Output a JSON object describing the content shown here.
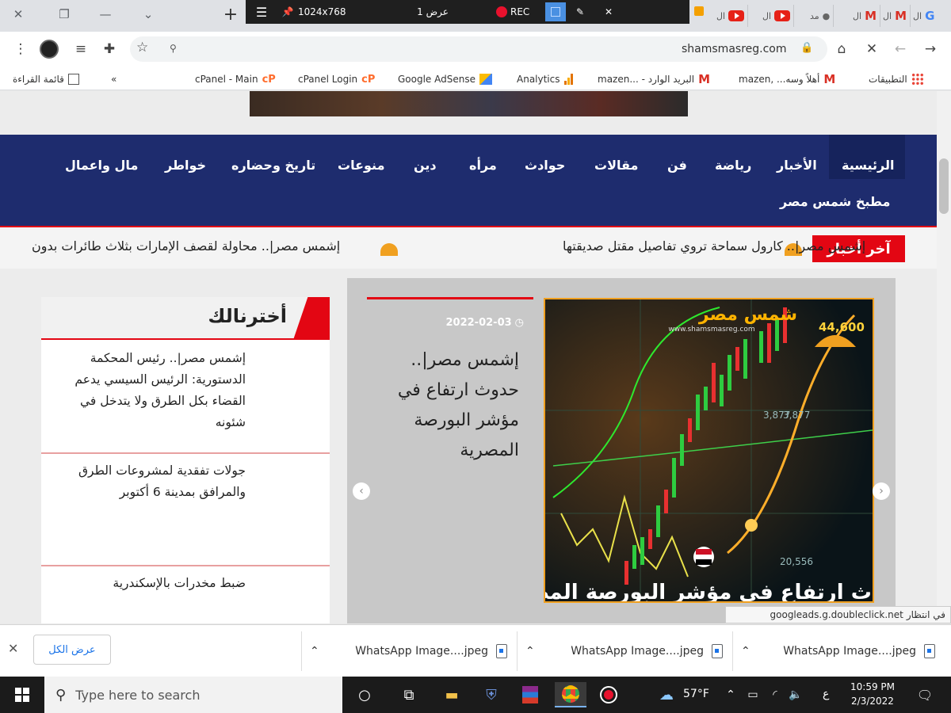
{
  "browser": {
    "tabs": [
      {
        "label": "ال",
        "icon": "youtube-icon"
      },
      {
        "label": "ال",
        "icon": "youtube-icon"
      },
      {
        "label": "مد",
        "icon": "user-icon"
      },
      {
        "label": "ال",
        "icon": "gmail-icon"
      },
      {
        "label": "ال",
        "icon": "gmail-icon"
      },
      {
        "label": "ال",
        "icon": "google-icon"
      }
    ],
    "address": "shamsmasreg.com",
    "zoom": "90",
    "bookmarks": [
      {
        "label": "التطبيقات",
        "icon": "apps-grid-icon"
      },
      {
        "label": "أهلاً وسه... ,mazen",
        "icon": "gmail-icon"
      },
      {
        "label": "البريد الوارد - ...mazen",
        "icon": "gmail-icon"
      },
      {
        "label": "Analytics",
        "icon": "analytics-icon"
      },
      {
        "label": "Google AdSense",
        "icon": "adsense-icon"
      },
      {
        "label": "cPanel Login",
        "icon": "cpanel-icon"
      },
      {
        "label": "cPanel - Main",
        "icon": "cpanel-icon"
      }
    ],
    "reading_list": "قائمة القراءة",
    "more_bookmarks": "«"
  },
  "recording": {
    "resolution": "1024x768",
    "display": "عرض 1",
    "rec_label": "REC"
  },
  "site": {
    "nav": [
      "الرئيسية",
      "الأخبار",
      "رياضة",
      "فن",
      "مقالات",
      "حوادث",
      "مرأه",
      "دين",
      "منوعات",
      "تاريخ وحضاره",
      "خواطر",
      "مال واعمال"
    ],
    "nav_row2": "مطبخ شمس مصر",
    "ticker_label": "آخر أخبار",
    "ticker": [
      "إشمس مصر|.. كارول سماحة تروي تفاصيل مقتل صديقتها",
      "إشمس مصر|.. محاولة لقصف الإمارات بثلاث طائرات بدون"
    ],
    "slide": {
      "date": "2022-02-03",
      "title": "إشمس مصر|.. حدوث ارتفاع في مؤشر البورصة المصرية",
      "logo_text": "شمس مصر",
      "logo_url": "www.shamsmasreg.com",
      "caption": "حدوث ارتفاع في مؤشر البورصة المصرية",
      "prices": [
        "44,600",
        "3,877",
        "3,877",
        "20,556"
      ]
    },
    "sidebar": {
      "title": "أخترنالك",
      "items": [
        "إشمس مصر|.. رئيس المحكمة الدستورية: الرئيس السيسي يدعم القضاء بكل الطرق ولا يتدخل في شئونه",
        "جولات تفقدية لمشروعات الطرق والمرافق بمدينة 6 أكتوبر",
        "ضبط مخدرات بالإسكندرية"
      ]
    }
  },
  "status": {
    "waiting": "في انتظار",
    "url": "googleads.g.doubleclick.net"
  },
  "downloads": {
    "show_all": "عرض الكل",
    "items": [
      "WhatsApp Image....jpeg",
      "WhatsApp Image....jpeg",
      "WhatsApp Image....jpeg"
    ]
  },
  "taskbar": {
    "search_placeholder": "Type here to search",
    "weather": "57°F",
    "lang": "ع",
    "time": "10:59 PM",
    "date": "2/3/2022"
  },
  "colors": {
    "nav_bg": "#1e2c6e",
    "accent_red": "#e30613",
    "rec_red": "#e8112d"
  }
}
